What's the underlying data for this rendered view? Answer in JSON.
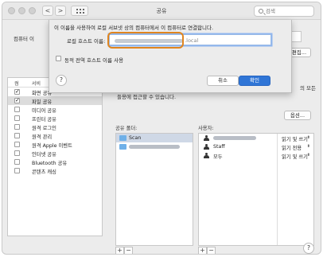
{
  "window": {
    "title": "공유"
  },
  "toolbar": {
    "back_label": "<",
    "forward_label": ">",
    "search_placeholder": "검색"
  },
  "background": {
    "computer_name_label": "컴퓨터 이",
    "edit_button_label": "편집...",
    "description_text": "들용에 접근할 수 있습니다.",
    "trailing_text": "의 모든",
    "options_button_label": "옵션..."
  },
  "services": {
    "header_on": "켬",
    "header_service": "서비",
    "items": [
      {
        "label": "화면 공유",
        "checked": true,
        "selected": false
      },
      {
        "label": "파일 공유",
        "checked": true,
        "selected": true
      },
      {
        "label": "미디어 공유",
        "checked": false,
        "selected": false
      },
      {
        "label": "프린터 공유",
        "checked": false,
        "selected": false
      },
      {
        "label": "원격 로그인",
        "checked": false,
        "selected": false
      },
      {
        "label": "원격 관리",
        "checked": false,
        "selected": false
      },
      {
        "label": "원격 Apple 이벤트",
        "checked": false,
        "selected": false
      },
      {
        "label": "인터넷 공유",
        "checked": false,
        "selected": false
      },
      {
        "label": "Bluetooth 공유",
        "checked": false,
        "selected": false
      },
      {
        "label": "콘텐츠 캐싱",
        "checked": false,
        "selected": false
      }
    ]
  },
  "shared_folders": {
    "label": "공유 폴더:",
    "items": [
      {
        "name": "Scan",
        "selected": true
      },
      {
        "name": "",
        "selected": false
      }
    ],
    "add_label": "+",
    "remove_label": "−"
  },
  "users": {
    "label": "사용자:",
    "items": [
      {
        "name": "",
        "permission": "읽기 및 쓰기"
      },
      {
        "name": "Staff",
        "permission": "읽기 전용"
      },
      {
        "name": "모두",
        "permission": "읽기 및 쓰기"
      }
    ],
    "add_label": "+",
    "remove_label": "−"
  },
  "sheet": {
    "message": "이 이름을 사용하여 로컬 서브넷 상의 컴퓨터에서 이 컴퓨터로 연결합니다.",
    "host_label": "로컬 호스트 이름:",
    "host_value_suffix": ".local",
    "dynamic_label": "동적 전역 호스트 이름 사용",
    "cancel_label": "취소",
    "ok_label": "확인",
    "help_label": "?"
  },
  "help_label": "?",
  "colors": {
    "accent": "#2f75d6",
    "highlight_ring": "#e0851f",
    "folder": "#6fb0e8"
  }
}
